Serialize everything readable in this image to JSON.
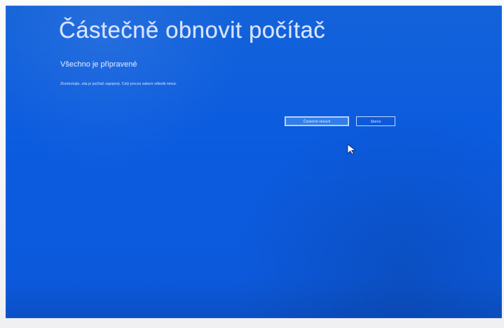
{
  "dialog": {
    "title": "Částečně obnovit počítač",
    "subtitle": "Všechno je připravené",
    "description": "Zkontrolujte, zda je počítač zapojený. Celý proces zabere několik minut."
  },
  "buttons": {
    "primary_label": "Částečně obnovit",
    "secondary_label": "Storno"
  },
  "icons": {
    "pointer": "mouse-pointer-icon"
  },
  "colors": {
    "screen_background": "#0b58dc",
    "text": "#d8e4ff",
    "button_border": "#d6e6ff",
    "primary_button": "#5ca4f5"
  }
}
